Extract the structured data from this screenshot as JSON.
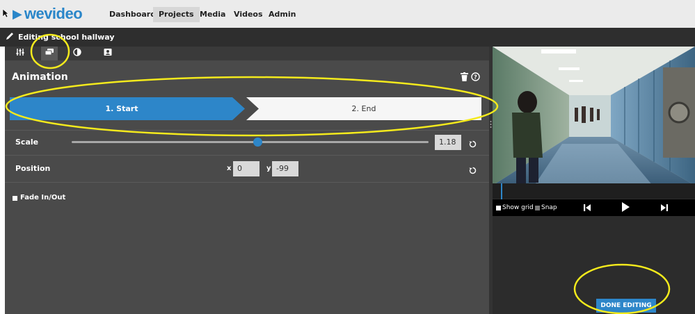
{
  "brand": {
    "name": "wevideo"
  },
  "nav": {
    "items": [
      {
        "label": "Dashboard",
        "active": false
      },
      {
        "label": "Projects",
        "active": true
      },
      {
        "label": "Media",
        "active": false
      },
      {
        "label": "Videos",
        "active": false
      },
      {
        "label": "Admin",
        "active": false
      }
    ]
  },
  "editbar": {
    "label": "Editing school hallway"
  },
  "tools": {
    "tabs": [
      {
        "icon": "sliders-icon",
        "active": false
      },
      {
        "icon": "layers-icon",
        "active": true
      },
      {
        "icon": "contrast-icon",
        "active": false
      },
      {
        "icon": "image-icon",
        "active": false
      }
    ]
  },
  "animation": {
    "title": "Animation",
    "steps": [
      {
        "label": "1. Start",
        "active": true
      },
      {
        "label": "2. End",
        "active": false
      }
    ],
    "scale": {
      "label": "Scale",
      "value": "1.18",
      "slider_fraction": 0.52
    },
    "position": {
      "label": "Position",
      "x_label": "x",
      "x_value": "0",
      "y_label": "y",
      "y_value": "-99"
    },
    "fade": {
      "label": "Fade In/Out",
      "checked": true
    }
  },
  "preview": {
    "show_grid_label": "Show grid",
    "snap_label": "Snap",
    "show_grid_checked": true,
    "snap_checked": false
  },
  "done_button": {
    "label": "DONE EDITING"
  },
  "colors": {
    "accent": "#2d86c9",
    "annotation": "#f4ea1c"
  }
}
